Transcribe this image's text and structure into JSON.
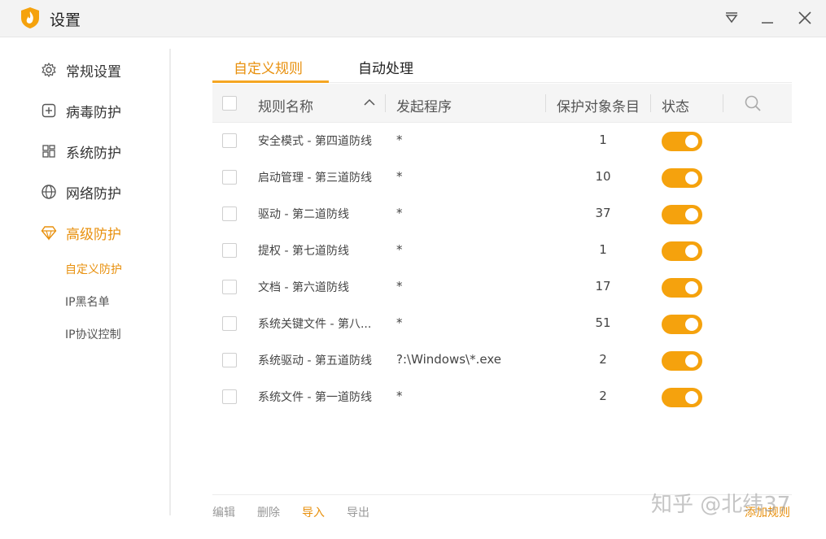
{
  "window": {
    "title": "设置",
    "menu_icon": "dropdown-triangle-icon",
    "minimize_icon": "minimize-icon",
    "close_icon": "close-icon"
  },
  "sidebar": {
    "items": [
      {
        "label": "常规设置",
        "icon": "gear-icon"
      },
      {
        "label": "病毒防护",
        "icon": "plus-square-icon"
      },
      {
        "label": "系统防护",
        "icon": "grid-icon"
      },
      {
        "label": "网络防护",
        "icon": "globe-icon"
      },
      {
        "label": "高级防护",
        "icon": "diamond-icon"
      }
    ],
    "sub_items": [
      "自定义防护",
      "IP黑名单",
      "IP协议控制"
    ]
  },
  "tabs": [
    "自定义规则",
    "自动处理"
  ],
  "table": {
    "headers": {
      "name": "规则名称",
      "program": "发起程序",
      "count": "保护对象条目",
      "status": "状态"
    },
    "rows": [
      {
        "name": "安全模式 - 第四道防线",
        "program": "*",
        "count": "1",
        "enabled": true
      },
      {
        "name": "启动管理 - 第三道防线",
        "program": "*",
        "count": "10",
        "enabled": true
      },
      {
        "name": "驱动 - 第二道防线",
        "program": "*",
        "count": "37",
        "enabled": true
      },
      {
        "name": "提权 - 第七道防线",
        "program": "*",
        "count": "1",
        "enabled": true
      },
      {
        "name": "文档 - 第六道防线",
        "program": "*",
        "count": "17",
        "enabled": true
      },
      {
        "name": "系统关键文件 - 第八...",
        "program": "*",
        "count": "51",
        "enabled": true
      },
      {
        "name": "系统驱动 - 第五道防线",
        "program": "?:\\Windows\\*.exe",
        "count": "2",
        "enabled": true
      },
      {
        "name": "系统文件 - 第一道防线",
        "program": "*",
        "count": "2",
        "enabled": true
      }
    ]
  },
  "footer": {
    "edit": "编辑",
    "delete": "删除",
    "import": "导入",
    "export": "导出",
    "add_rule": "添加规则"
  },
  "watermark": "知乎 @北纬37",
  "colors": {
    "accent": "#e8900d",
    "toggle_on": "#f5a20d"
  }
}
